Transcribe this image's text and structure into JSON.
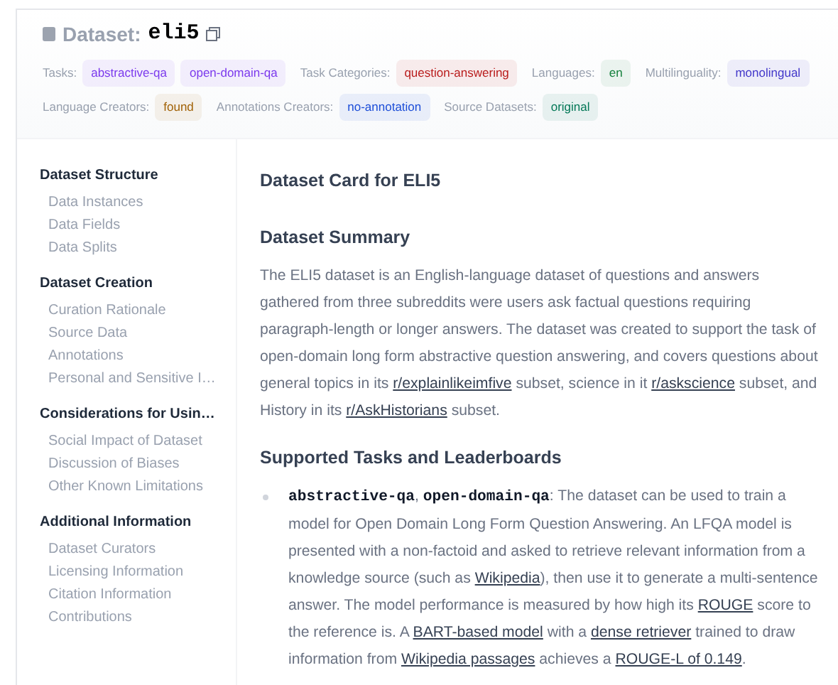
{
  "header": {
    "label": "Dataset:",
    "name": "eli5"
  },
  "tag_rows": [
    [
      {
        "label": "Tasks:",
        "tags": [
          {
            "text": "abstractive-qa",
            "color": "#7c3aed"
          },
          {
            "text": "open-domain-qa",
            "color": "#7c3aed"
          }
        ]
      },
      {
        "label": "Task Categories:",
        "tags": [
          {
            "text": "question-answering",
            "color": "#b91c1c"
          }
        ]
      },
      {
        "label": "Languages:",
        "tags": [
          {
            "text": "en",
            "color": "#15803d"
          }
        ]
      },
      {
        "label": "Multilinguality:",
        "tags": [
          {
            "text": "monolingual",
            "color": "#4338ca"
          }
        ]
      }
    ],
    [
      {
        "label": "Language Creators:",
        "tags": [
          {
            "text": "found",
            "color": "#a16207"
          }
        ]
      },
      {
        "label": "Annotations Creators:",
        "tags": [
          {
            "text": "no-annotation",
            "color": "#1d4ed8"
          }
        ]
      },
      {
        "label": "Source Datasets:",
        "tags": [
          {
            "text": "original",
            "color": "#047857"
          }
        ]
      }
    ]
  ],
  "sidebar": [
    {
      "title": "Dataset Structure",
      "items": [
        "Data Instances",
        "Data Fields",
        "Data Splits"
      ]
    },
    {
      "title": "Dataset Creation",
      "items": [
        "Curation Rationale",
        "Source Data",
        "Annotations",
        "Personal and Sensitive I…"
      ]
    },
    {
      "title": "Considerations for Usin…",
      "items": [
        "Social Impact of Dataset",
        "Discussion of Biases",
        "Other Known Limitations"
      ]
    },
    {
      "title": "Additional Information",
      "items": [
        "Dataset Curators",
        "Licensing Information",
        "Citation Information",
        "Contributions"
      ]
    }
  ],
  "content": [
    {
      "kind": "heading",
      "text": "Dataset Card for ELI5"
    },
    {
      "kind": "heading",
      "text": "Dataset Summary"
    },
    {
      "kind": "paragraph",
      "segments": [
        {
          "kind": "text",
          "text": "The ELI5 dataset is an English-language dataset of questions and answers gathered from three subreddits were users ask factual questions requiring paragraph-length or longer answers. The dataset was created to support the task of open-domain long form abstractive question answering, and covers questions about general topics in its "
        },
        {
          "kind": "link",
          "text": "r/explainlikeimfive"
        },
        {
          "kind": "text",
          "text": " subset, science in it "
        },
        {
          "kind": "link",
          "text": "r/askscience"
        },
        {
          "kind": "text",
          "text": " subset, and History in its "
        },
        {
          "kind": "link",
          "text": "r/AskHistorians"
        },
        {
          "kind": "text",
          "text": " subset."
        }
      ]
    },
    {
      "kind": "heading",
      "text": "Supported Tasks and Leaderboards"
    },
    {
      "kind": "bullet",
      "segments": [
        {
          "kind": "code",
          "text": "abstractive-qa"
        },
        {
          "kind": "text",
          "text": ", "
        },
        {
          "kind": "code",
          "text": "open-domain-qa"
        },
        {
          "kind": "text",
          "text": ": The dataset can be used to train a model for Open Domain Long Form Question Answering. An LFQA model is presented with a non-factoid and asked to retrieve relevant information from a knowledge source (such as "
        },
        {
          "kind": "link",
          "text": "Wikipedia"
        },
        {
          "kind": "text",
          "text": "), then use it to generate a multi-sentence answer. The model performance is measured by how high its "
        },
        {
          "kind": "link",
          "text": "ROUGE"
        },
        {
          "kind": "text",
          "text": " score to the reference is. A "
        },
        {
          "kind": "link",
          "text": "BART-based model"
        },
        {
          "kind": "text",
          "text": " with a "
        },
        {
          "kind": "link",
          "text": "dense retriever"
        },
        {
          "kind": "text",
          "text": " trained to draw information from "
        },
        {
          "kind": "link",
          "text": "Wikipedia passages"
        },
        {
          "kind": "text",
          "text": " achieves a "
        },
        {
          "kind": "link",
          "text": "ROUGE-L of 0.149"
        },
        {
          "kind": "text",
          "text": "."
        }
      ]
    }
  ]
}
